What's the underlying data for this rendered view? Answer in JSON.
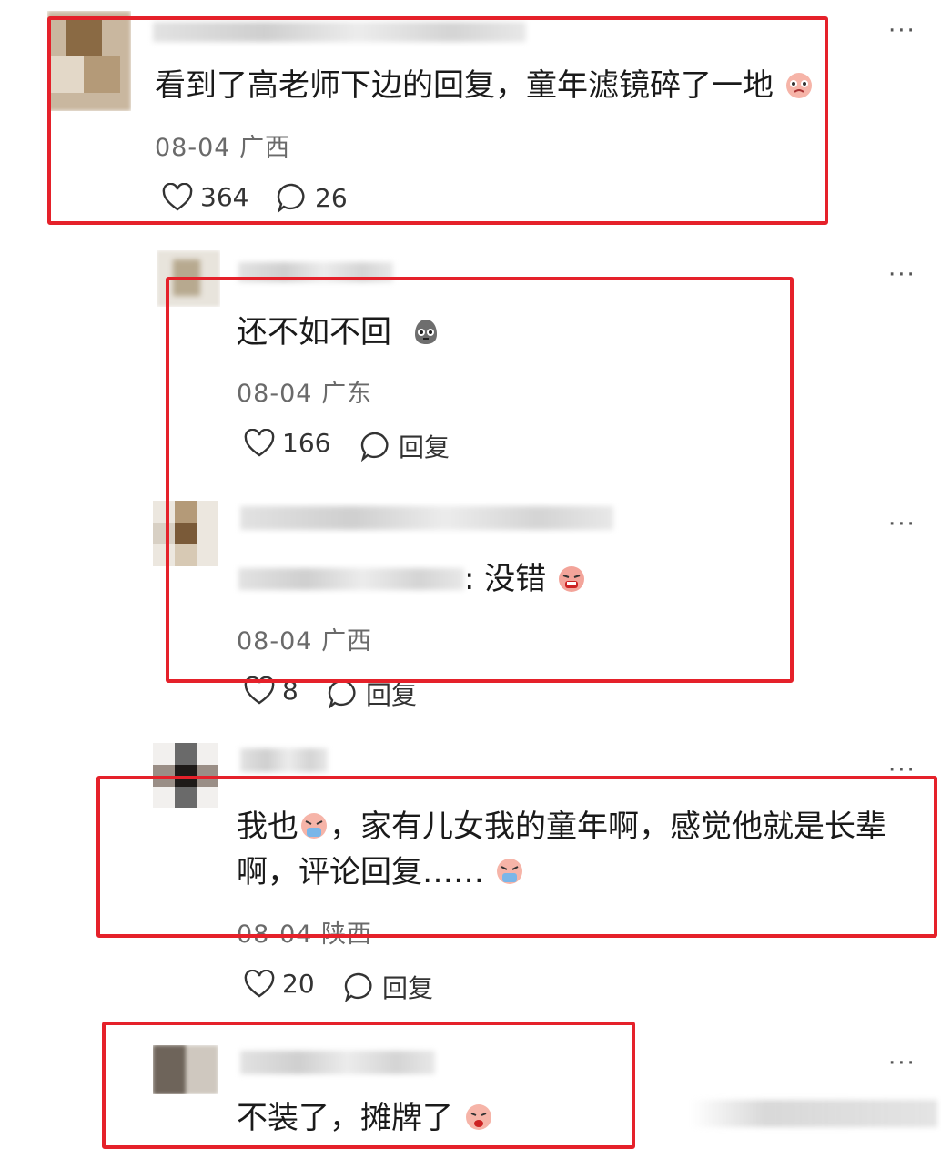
{
  "comments": [
    {
      "text": "看到了高老师下边的回复，童年滤镜碎了一地",
      "date": "08-04",
      "region": "广西",
      "likes": "364",
      "replies": "26"
    },
    {
      "text": "还不如不回",
      "date": "08-04",
      "region": "广东",
      "likes": "166",
      "reply_label": "回复"
    },
    {
      "text_suffix": ": 没错",
      "date": "08-04",
      "region": "广西",
      "likes": "8",
      "reply_label": "回复"
    },
    {
      "text_line1_a": "我也",
      "text_line1_b": "，家有儿女我的童年啊，感觉他就是长辈",
      "text_line2": "啊，评论回复……",
      "date": "08-04",
      "region": "陕西",
      "likes": "20",
      "reply_label": "回复"
    },
    {
      "text": "不装了，摊牌了"
    }
  ],
  "more_label": "···",
  "colors": {
    "highlight": "#e5212a",
    "meta": "#6a6a6a"
  },
  "icons": [
    "heart-icon",
    "comment-bubble-icon",
    "more-icon",
    "emoji-icon"
  ]
}
